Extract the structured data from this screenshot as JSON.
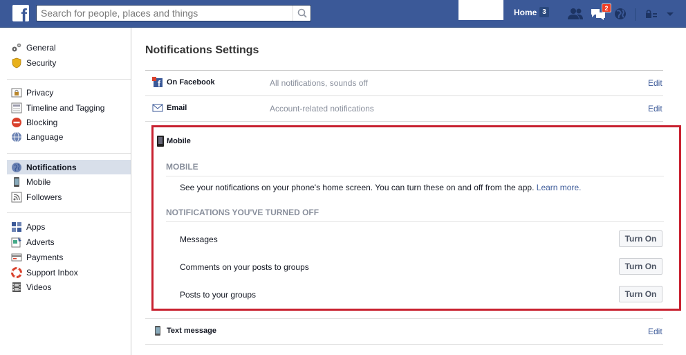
{
  "topbar": {
    "logo": "f",
    "search_placeholder": "Search for people, places and things",
    "home_label": "Home",
    "home_count": "3",
    "messages_badge": "2",
    "colors": {
      "bar": "#3b5998",
      "badge": "#f03d25"
    }
  },
  "sidebar": {
    "groups": [
      [
        {
          "label": "General",
          "icon": "gears-icon"
        },
        {
          "label": "Security",
          "icon": "shield-icon"
        }
      ],
      [
        {
          "label": "Privacy",
          "icon": "lock-icon"
        },
        {
          "label": "Timeline and Tagging",
          "icon": "timeline-icon"
        },
        {
          "label": "Blocking",
          "icon": "blocking-icon"
        },
        {
          "label": "Language",
          "icon": "globe-icon"
        }
      ],
      [
        {
          "label": "Notifications",
          "icon": "notifications-globe-icon",
          "active": true
        },
        {
          "label": "Mobile",
          "icon": "phone-icon"
        },
        {
          "label": "Followers",
          "icon": "rss-icon"
        }
      ],
      [
        {
          "label": "Apps",
          "icon": "apps-icon"
        },
        {
          "label": "Adverts",
          "icon": "adverts-icon"
        },
        {
          "label": "Payments",
          "icon": "credit-card-icon"
        },
        {
          "label": "Support Inbox",
          "icon": "lifebuoy-icon"
        },
        {
          "label": "Videos",
          "icon": "film-icon"
        }
      ]
    ]
  },
  "main": {
    "title": "Notifications Settings",
    "on_facebook": {
      "title": "On Facebook",
      "desc": "All notifications, sounds off",
      "edit": "Edit"
    },
    "email": {
      "title": "Email",
      "desc": "Account-related notifications",
      "edit": "Edit"
    },
    "mobile": {
      "title": "Mobile",
      "section_mobile": "MOBILE",
      "mobile_text": "See your notifications on your phone's home screen. You can turn these on and off from the app.",
      "learn_more": "Learn more.",
      "section_off": "NOTIFICATIONS YOU'VE TURNED OFF",
      "items": [
        {
          "label": "Messages",
          "button": "Turn On"
        },
        {
          "label": "Comments on your posts to groups",
          "button": "Turn On"
        },
        {
          "label": "Posts to your groups",
          "button": "Turn On"
        }
      ]
    },
    "text_message": {
      "title": "Text message",
      "edit": "Edit"
    }
  }
}
